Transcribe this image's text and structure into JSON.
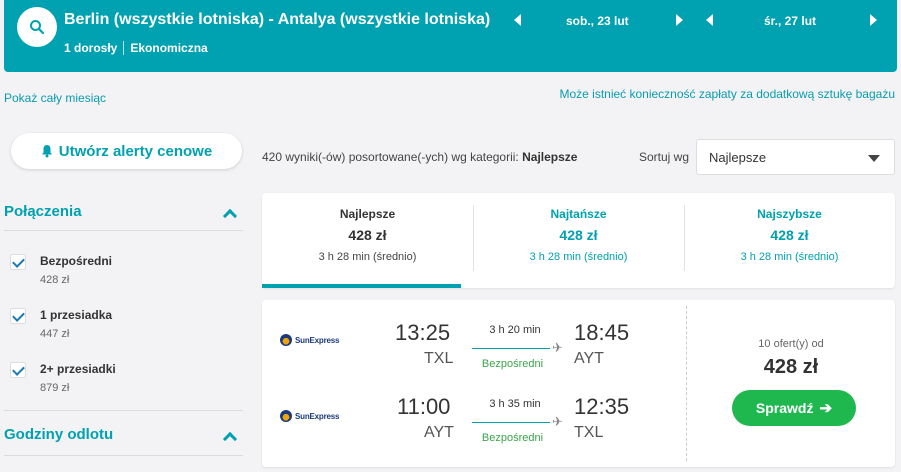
{
  "header": {
    "route": "Berlin (wszystkie lotniska) - Antalya (wszystkie lotniska)",
    "passengers": "1 dorosły",
    "cabin": "Ekonomiczna",
    "depart_date": "sob., 23 lut",
    "return_date": "śr., 27 lut"
  },
  "links": {
    "show_month": "Pokaż cały miesiąc",
    "baggage_note": "Może istnieć konieczność zapłaty za dodatkową sztukę bagażu"
  },
  "alert_button": "Utwórz alerty cenowe",
  "results": {
    "count_text": "420 wyniki(-ów) posortowane(-ych) wg kategorii: ",
    "category": "Najlepsze"
  },
  "sort": {
    "label": "Sortuj wg",
    "selected": "Najlepsze"
  },
  "sidebar": {
    "connections_title": "Połączenia",
    "filters": [
      {
        "label": "Bezpośredni",
        "price": "428 zł",
        "checked": true
      },
      {
        "label": "1 przesiadka",
        "price": "447 zł",
        "checked": true
      },
      {
        "label": "2+ przesiadki",
        "price": "879 zł",
        "checked": true
      }
    ],
    "departure_title": "Godziny odlotu"
  },
  "tabs": [
    {
      "title": "Najlepsze",
      "price": "428 zł",
      "duration": "3 h 28 min (średnio)",
      "active": true
    },
    {
      "title": "Najtańsze",
      "price": "428 zł",
      "duration": "3 h 28 min (średnio)",
      "active": false
    },
    {
      "title": "Najszybsze",
      "price": "428 zł",
      "duration": "3 h 28 min (średnio)",
      "active": false
    }
  ],
  "flight": {
    "legs": [
      {
        "airline": "SunExpress",
        "dep_time": "13:25",
        "dep_code": "TXL",
        "duration": "3 h 20 min",
        "stops": "Bezpośredni",
        "arr_time": "18:45",
        "arr_code": "AYT"
      },
      {
        "airline": "SunExpress",
        "dep_time": "11:00",
        "dep_code": "AYT",
        "duration": "3 h 35 min",
        "stops": "Bezpośredni",
        "arr_time": "12:35",
        "arr_code": "TXL"
      }
    ],
    "offers": "10 ofert(y) od",
    "price": "428 zł",
    "cta": "Sprawdź"
  },
  "colors": {
    "accent": "#00a1b0",
    "cta": "#1fb84f",
    "direct": "#3aa54a"
  }
}
